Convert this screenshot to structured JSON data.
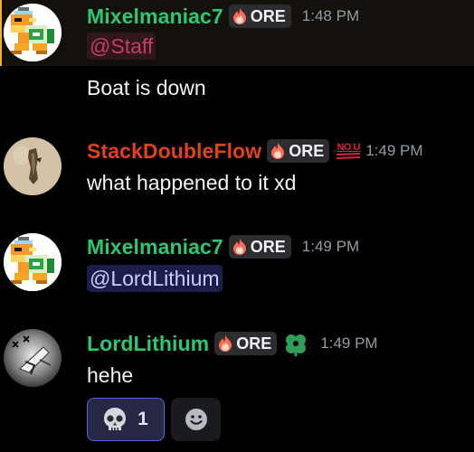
{
  "messages": [
    {
      "username": "Mixelmaniac7",
      "name_color": "#2dc770",
      "tag": "ORE",
      "timestamp": "1:48 PM",
      "mention": "@Staff",
      "text": "Boat is down",
      "avatar_icon": "pixel-koopa-avatar"
    },
    {
      "username": "StackDoubleFlow",
      "name_color": "#e0431c",
      "tag": "ORE",
      "badge": "NO U",
      "timestamp": "1:49 PM",
      "text": "what happened to it xd",
      "avatar_icon": "stick-avatar"
    },
    {
      "username": "Mixelmaniac7",
      "name_color": "#2dc770",
      "tag": "ORE",
      "timestamp": "1:49 PM",
      "mention": "@LordLithium",
      "avatar_icon": "pixel-koopa-avatar"
    },
    {
      "username": "LordLithium",
      "name_color": "#2dc770",
      "tag": "ORE",
      "timestamp": "1:49 PM",
      "text": "hehe",
      "avatar_icon": "metallic-sketch-avatar",
      "role_icon": "green-clover-icon",
      "reactions": [
        {
          "emoji": "skull-icon",
          "count": "1"
        }
      ]
    }
  ],
  "colors": {
    "background": "#000000",
    "highlight_bar": "#f0b132",
    "mention_staff": "#c93a6a",
    "mention_user": "#c9cdfb",
    "reaction_active_border": "#5865f2",
    "timestamp": "#949ba4"
  }
}
